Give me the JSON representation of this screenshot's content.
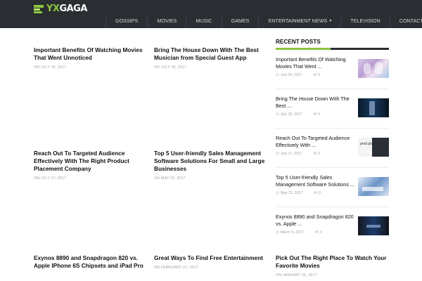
{
  "header": {
    "logo": {
      "prefix": "YX",
      "suffix": "GAGA"
    },
    "nav": [
      {
        "label": "GOSSIPS",
        "dropdown": false
      },
      {
        "label": "MOVIES",
        "dropdown": false
      },
      {
        "label": "MUSIC",
        "dropdown": false
      },
      {
        "label": "GAMES",
        "dropdown": false
      },
      {
        "label": "ENTERTAINMENT NEWS",
        "dropdown": true
      },
      {
        "label": "TELEVISION",
        "dropdown": false
      },
      {
        "label": "CONTACT",
        "dropdown": false
      }
    ]
  },
  "posts": [
    {
      "title": "Important Benefits Of Watching Movies That Went Unnoticed",
      "date": "ON JULY 24, 2017"
    },
    {
      "title": "Bring The House Down With The Best Musician from Special Guest App",
      "date": "ON JULY 18, 2017"
    },
    {
      "title": "Reach Out To Targeted Audience Effectively With The Right Product Placement Company",
      "date": "ON JULY 17, 2017"
    },
    {
      "title": "Top 5 User-friendly Sales Management Software Solutions For Small and Large Businesses",
      "date": "ON MAY 23, 2017"
    },
    {
      "title": "Exynos 8890 and Snapdragon 820 vs. Apple IPhone 6S Chipsets and iPad Pro",
      "date": ""
    },
    {
      "title": "Great Ways To Find Free Entertainment",
      "date": "ON FEBRUARY 27, 2017"
    },
    {
      "title": "Pick Out The Right Place To Watch Your Favorite Movies",
      "date": "ON JANUARY 25, 2017"
    }
  ],
  "sidebar": {
    "heading": "RECENT POSTS",
    "items": [
      {
        "title": "Important Benefits Of Watching Movies That Went ...",
        "date": "July 24, 2017",
        "comments": "0"
      },
      {
        "title": "Bring The House Down With The Best ...",
        "date": "July 18, 2017",
        "comments": "0"
      },
      {
        "title": "Reach Out To Targeted Audience Effectively With ...",
        "date": "July 17, 2017",
        "comments": "0"
      },
      {
        "title": "Top 5 User-friendly Sales Management Software Solutions ...",
        "date": "May 23, 2017",
        "comments": "0"
      },
      {
        "title": "Exynos 8890 and Snapdragon 820 vs. Apple ...",
        "date": "March 6, 2017",
        "comments": "0"
      }
    ],
    "thumb3_text": "prod placem"
  },
  "colors": {
    "topbar": "#2a2d31",
    "accent": "#8cc63f"
  }
}
